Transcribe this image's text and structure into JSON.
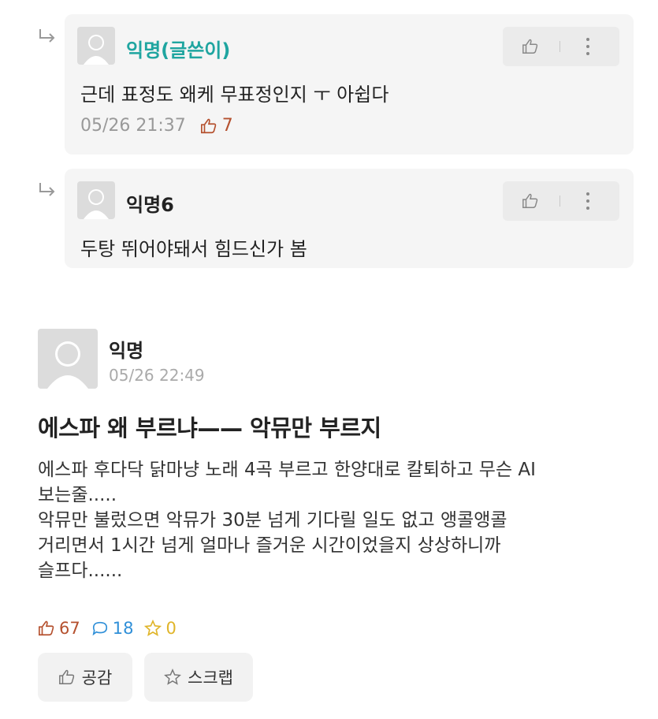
{
  "replies": [
    {
      "name": "익명(글쓴이)",
      "text": "근데 표정도 왜케 무표정인지 ㅜ 아쉽다",
      "time": "05/26 21:37",
      "likes": "7"
    },
    {
      "name": "익명6",
      "text": "두탕 뛰어야돼서 힘드신가 봄"
    }
  ],
  "post": {
    "author": "익명",
    "time": "05/26 22:49",
    "title": "에스파 왜 부르냐—— 악뮤만 부르지",
    "body_lines": [
      "에스파 후다닥 닭마냥 노래 4곡 부르고 한양대로 칼퇴하고 무슨 AI",
      "보는줄.....",
      "악뮤만 불렀으면 악뮤가 30분 넘게 기다릴 일도 없고 앵콜앵콜",
      "거리면서 1시간 넘게 얼마나 즐거운 시간이었을지 상상하니까",
      "슬프다......"
    ],
    "likes": "67",
    "comments": "18",
    "scraps": "0",
    "empathy_label": "공감",
    "scrap_label": "스크랩"
  },
  "colors": {
    "author_accent": "#1fa5a0",
    "like": "#b5512f",
    "comment": "#2f8fd8",
    "scrap": "#e0b52a"
  }
}
